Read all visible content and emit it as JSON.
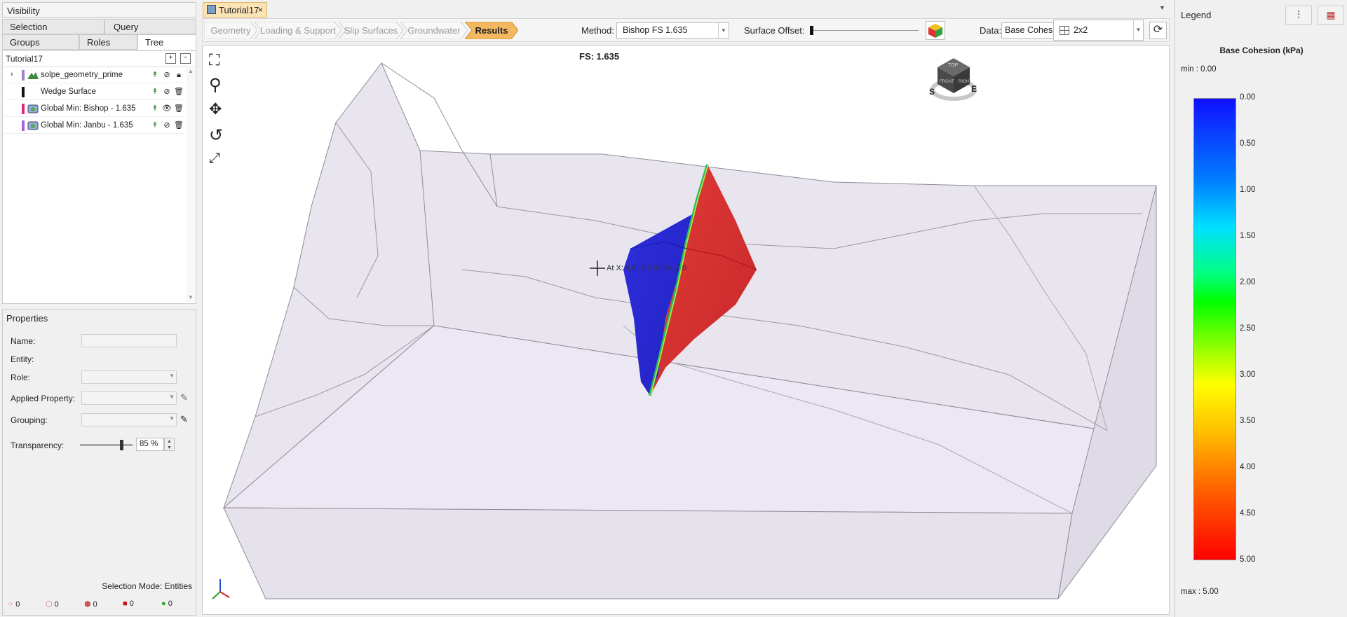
{
  "visibility": {
    "title": "Visibility",
    "tabs_row1": [
      "Selection",
      "Query"
    ],
    "tabs_row2": [
      "Groups",
      "Roles",
      "Tree"
    ],
    "tree_root": "Tutorial17",
    "items": [
      {
        "label": "solpe_geometry_prime",
        "color": "#9a84c8",
        "icon": "terrain-icon"
      },
      {
        "label": "Wedge Surface",
        "color": "#111111",
        "icon": "none"
      },
      {
        "label": "Global Min: Bishop  -  1.635",
        "color": "#e0267a",
        "icon": "slip-surface-icon"
      },
      {
        "label": "Global Min: Janbu  -  1.635",
        "color": "#a860e0",
        "icon": "slip-surface-icon"
      }
    ]
  },
  "properties": {
    "title": "Properties",
    "labels": {
      "name": "Name:",
      "entity": "Entity:",
      "role": "Role:",
      "applied": "Applied Property:",
      "grouping": "Grouping:",
      "transparency": "Transparency:"
    },
    "transparency_value": "85 %",
    "transparency_level": 0.85,
    "selection_mode": "Selection Mode:  Entities",
    "counts": [
      "0",
      "0",
      "0",
      "0",
      "0"
    ]
  },
  "document_tab": "Tutorial17",
  "workflow": {
    "steps": [
      "Geometry",
      "Loading & Support",
      "Slip Surfaces",
      "Groundwater",
      "Results"
    ],
    "active": "Results"
  },
  "toolbar": {
    "method_label": "Method:",
    "method_value": "Bishop FS    1.635",
    "offset_label": "Surface Offset:",
    "data_label": "Data:",
    "data_value": "Base Cohesion",
    "layout_value": "2x2"
  },
  "viewport": {
    "fs_text": "FS: 1.635",
    "cursor_readout": "At X: 4.8, Y 210.98, Z 0",
    "cube_faces": {
      "top": "TOP",
      "front": "FRONT",
      "right": "RIGHT"
    },
    "compass": {
      "south": "S",
      "east": "E"
    }
  },
  "legend": {
    "title": "Legend",
    "data_title": "Base Cohesion (kPa)",
    "min_text": "min :   0.00",
    "max_text": "max :  5.00",
    "ticks": [
      "0.00",
      "0.50",
      "1.00",
      "1.50",
      "2.00",
      "2.50",
      "3.00",
      "3.50",
      "4.00",
      "4.50",
      "5.00"
    ]
  },
  "colors": {
    "accent": "#f4b860",
    "low": "#1010d8",
    "high": "#e01010"
  }
}
